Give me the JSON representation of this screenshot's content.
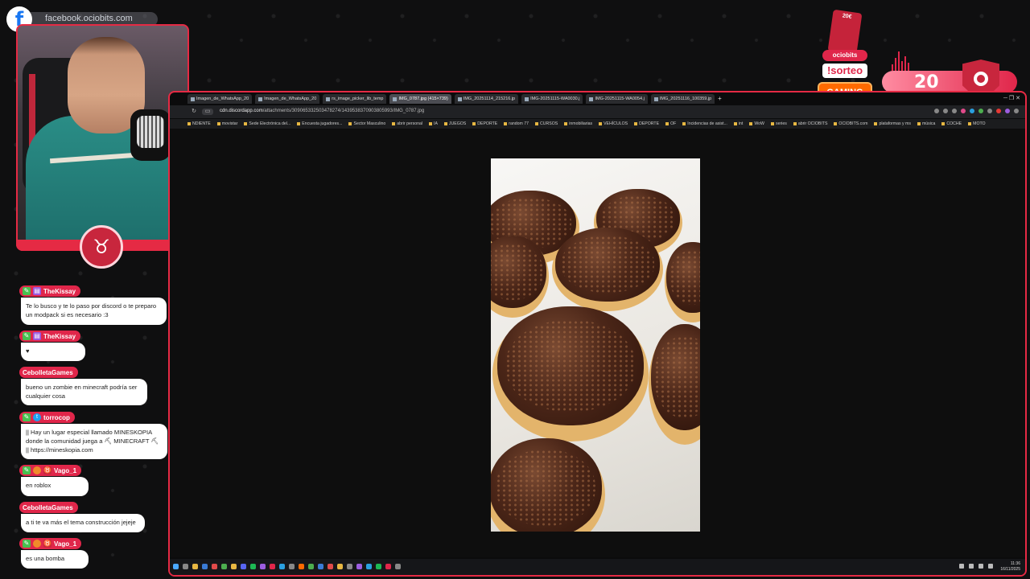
{
  "facebook": {
    "url": "facebook.ociobits.com"
  },
  "chat": [
    {
      "user": "TheKissay",
      "badges": [
        "green",
        "purple"
      ],
      "text": "Te lo busco y te lo paso por discord o te preparo un modpack si es necesario :3"
    },
    {
      "user": "TheKissay",
      "badges": [
        "green",
        "purple"
      ],
      "text": "♥"
    },
    {
      "user": "CebolletaGames",
      "badges": [],
      "text": "bueno un zombie en minecraft podría ser cualquier cosa"
    },
    {
      "user": "torrocop",
      "badges": [
        "green",
        "twitter"
      ],
      "text": "|| Hay un lugar especial llamado MINESKOPIA donde la comunidad juega a ⛏ MINECRAFT ⛏ || https://mineskopia.com"
    },
    {
      "user": "Vago_1",
      "badges": [
        "green",
        "orange",
        "red"
      ],
      "text": "en roblox"
    },
    {
      "user": "CebolletaGames",
      "badges": [],
      "text": "a ti te va más el tema construcción jejeje"
    },
    {
      "user": "Vago_1",
      "badges": [
        "green",
        "orange",
        "red"
      ],
      "text": "es una bomba"
    }
  ],
  "overlay": {
    "prize_amount": "20€",
    "brand": "ociobits",
    "sorteo": "!sorteo",
    "gaming": "GAMING",
    "counter": "20"
  },
  "browser": {
    "tabs": [
      {
        "label": "Imagen_de_WhatsApp_20",
        "active": false
      },
      {
        "label": "Imagen_de_WhatsApp_20",
        "active": false
      },
      {
        "label": "rs_image_picker_lib_temp",
        "active": false
      },
      {
        "label": "IMG_0787.jpg (415×739)",
        "active": true
      },
      {
        "label": "IMG_20251114_215216.jp",
        "active": false
      },
      {
        "label": "IMG-20251115-WA0030.j",
        "active": false
      },
      {
        "label": "IMG-20251115-WA0054.j",
        "active": false
      },
      {
        "label": "IMG_20251116_100359.jp",
        "active": false
      }
    ],
    "url_domain": "cdn.discordapp.com",
    "url_path": "/attachments/309065332503478274/1439538370903805993/IMG_0787.jpg",
    "bookmarks": [
      "NDIENTE",
      "movistar",
      "Sede Electrónica del...",
      "Encuesta jugadores...",
      "Sector Masculino",
      "abrir personal",
      "IA",
      "JUEGOS",
      "DEPORTE",
      "random 77",
      "CURSOS",
      "inmobiliarias",
      "VEHÍCULOS",
      "DEPORTE",
      "OF",
      "Incidencias de asist...",
      "int",
      "WoW",
      "series",
      "abrir OCIOBITS",
      "OCIOBITS.com",
      "plataformas y ms",
      "música",
      "COCHE",
      "MOTO"
    ],
    "clock_time": "11:36",
    "clock_date": "16/11/2025"
  },
  "colors": {
    "accent": "#e0264a",
    "frame": "#e52a44",
    "gaming": "#ff6a00"
  }
}
